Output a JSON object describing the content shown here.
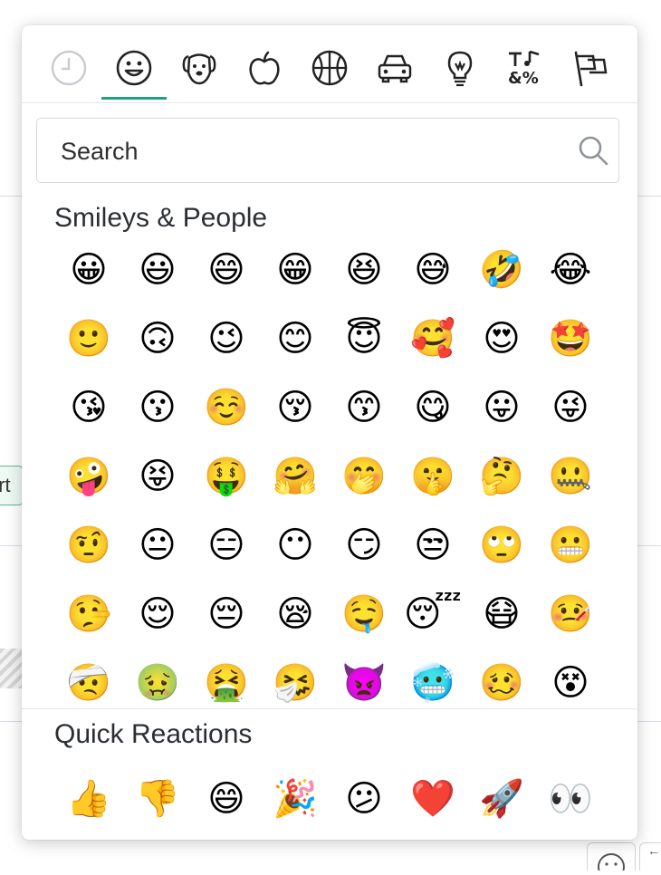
{
  "category_tabs": [
    {
      "id": "recent",
      "icon": "clock-icon",
      "active": false
    },
    {
      "id": "smileys",
      "icon": "smiley-face-icon",
      "active": true
    },
    {
      "id": "animals",
      "icon": "dog-face-icon",
      "active": false
    },
    {
      "id": "food",
      "icon": "apple-icon",
      "active": false
    },
    {
      "id": "activity",
      "icon": "basketball-icon",
      "active": false
    },
    {
      "id": "travel",
      "icon": "car-icon",
      "active": false
    },
    {
      "id": "objects",
      "icon": "lightbulb-icon",
      "active": false
    },
    {
      "id": "symbols",
      "icon": "symbols-icon",
      "active": false
    },
    {
      "id": "flags",
      "icon": "flags-icon",
      "active": false
    }
  ],
  "accent_color": "#1fa37f",
  "search": {
    "placeholder": "Search"
  },
  "sections": {
    "smileys_title": "Smileys & People",
    "quick_title": "Quick Reactions"
  },
  "smileys": [
    "😀",
    "😃",
    "😄",
    "😁",
    "😆",
    "😅",
    "🤣",
    "😂",
    "🙂",
    "🙃",
    "😉",
    "😊",
    "😇",
    "🥰",
    "😍",
    "🤩",
    "😘",
    "😗",
    "☺️",
    "😚",
    "😙",
    "😋",
    "😛",
    "😜",
    "🤪",
    "😝",
    "🤑",
    "🤗",
    "🤭",
    "🤫",
    "🤔",
    "🤐",
    "🤨",
    "😐",
    "😑",
    "😶",
    "😏",
    "😒",
    "🙄",
    "😬",
    "🤥",
    "😌",
    "😔",
    "😪",
    "🤤",
    "😴",
    "😷",
    "🤒",
    "🤕",
    "🤢",
    "🤮",
    "🤧",
    "👿",
    "🥶",
    "🥴",
    "😵"
  ],
  "quick_reactions": [
    "👍",
    "👎",
    "😄",
    "🎉",
    "😕",
    "❤️",
    "🚀",
    "👀"
  ],
  "background": {
    "chip_text": "art"
  }
}
